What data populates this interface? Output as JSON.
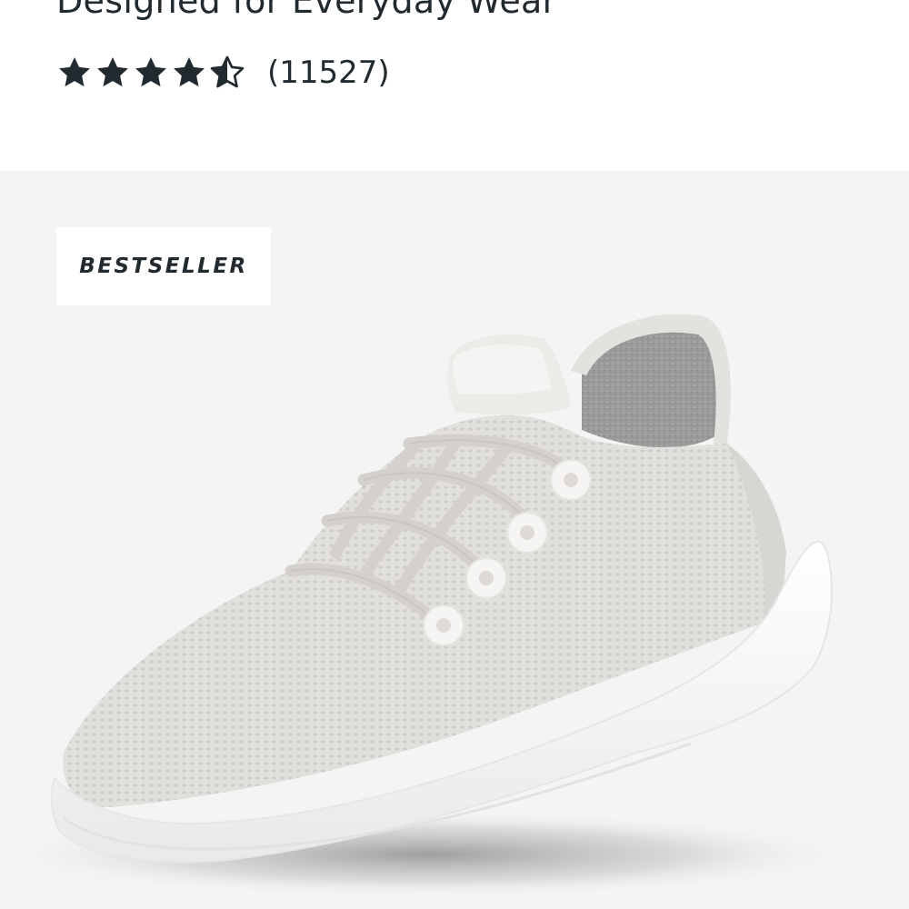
{
  "product": {
    "subtitle": "Designed for Everyday Wear",
    "rating": {
      "value": 4.5,
      "max": 5,
      "count_label": "(11527)",
      "star_color": "#212a2f"
    },
    "badge": "BESTSELLER",
    "image": {
      "description_name": "product-shoe-image",
      "background_color": "#f4f4f4"
    }
  }
}
